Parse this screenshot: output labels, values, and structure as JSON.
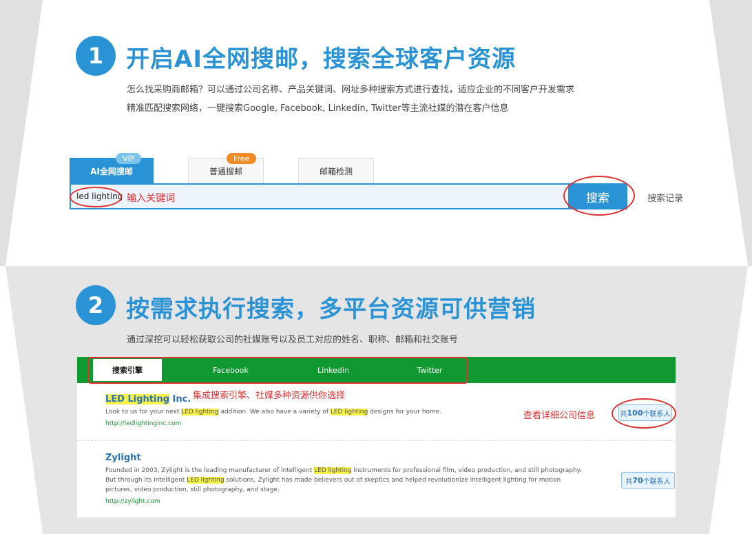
{
  "colors": {
    "accent": "#2a93d5",
    "green": "#119931",
    "annotation": "#e03131",
    "highlight": "#f5f04a"
  },
  "section1": {
    "number": "1",
    "heading": "开启AI全网搜邮，搜索全球客户资源",
    "desc_line1": "怎么找采购商邮箱？可以通过公司名称、产品关键词、网址多种搜索方式进行查找，适应企业的不同客户开发需求",
    "desc_line2": "精准匹配搜索网络，一键搜索Google, Facebook, Linkedin, Twitter等主流社媒的潜在客户信息"
  },
  "search": {
    "tabs": [
      {
        "label": "AI全网搜邮",
        "badge": "VIP"
      },
      {
        "label": "普通搜邮",
        "badge": "Free"
      },
      {
        "label": "邮箱检测"
      }
    ],
    "query": "led lighting",
    "placeholder": "输入关键词",
    "button": "搜索",
    "history": "搜索记录"
  },
  "section2": {
    "number": "2",
    "heading": "按需求执行搜索，多平台资源可供营销",
    "desc": "通过深挖可以轻松获取公司的社媒账号以及员工对应的姓名、职称、邮箱和社交账号"
  },
  "results": {
    "tabs": [
      "搜索引擎",
      "Facebook",
      "Linkedin",
      "Twitter"
    ],
    "annotation_sources": "集成搜索引擎、社媒多种资源供你选择",
    "annotation_details": "查看详细公司信息",
    "items": [
      {
        "title_hl": "LED Lighting",
        "title_rest": " Inc.",
        "desc": "Look to us for your next LED lighting addition. We also have a variety of LED lighting designs for your home.",
        "url": "http://ledlightinginc.com",
        "contacts_prefix": "共",
        "contacts_count": "100",
        "contacts_suffix": "个联系人"
      },
      {
        "title": "Zylight",
        "desc": "Founded in 2003, Zylight is the leading manufacturer of intelligent LED lighting instruments for professional film, video production, and still photography. But through its intelligent LED lighting solutions, Zylight has made believers out of skeptics and helped revolutionize intelligent lighting for motion pictures, video production, still photography, and stage.",
        "url": "http://zylight.com",
        "contacts_prefix": "共",
        "contacts_count": "70",
        "contacts_suffix": "个联系人"
      }
    ]
  }
}
